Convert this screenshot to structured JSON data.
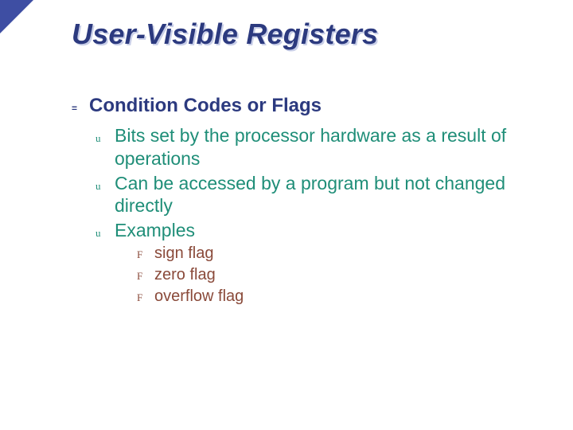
{
  "slide_title": "User-Visible Registers",
  "bullets": {
    "l1": "Condition Codes or Flags",
    "l2": [
      "Bits set by the processor hardware as a result of operations",
      "Can be accessed by a program but not changed directly",
      "Examples"
    ],
    "l3": [
      "sign flag",
      "zero flag",
      "overflow flag"
    ]
  },
  "bullet_chars": {
    "l1": "=",
    "l2": "u",
    "l3": "F"
  }
}
